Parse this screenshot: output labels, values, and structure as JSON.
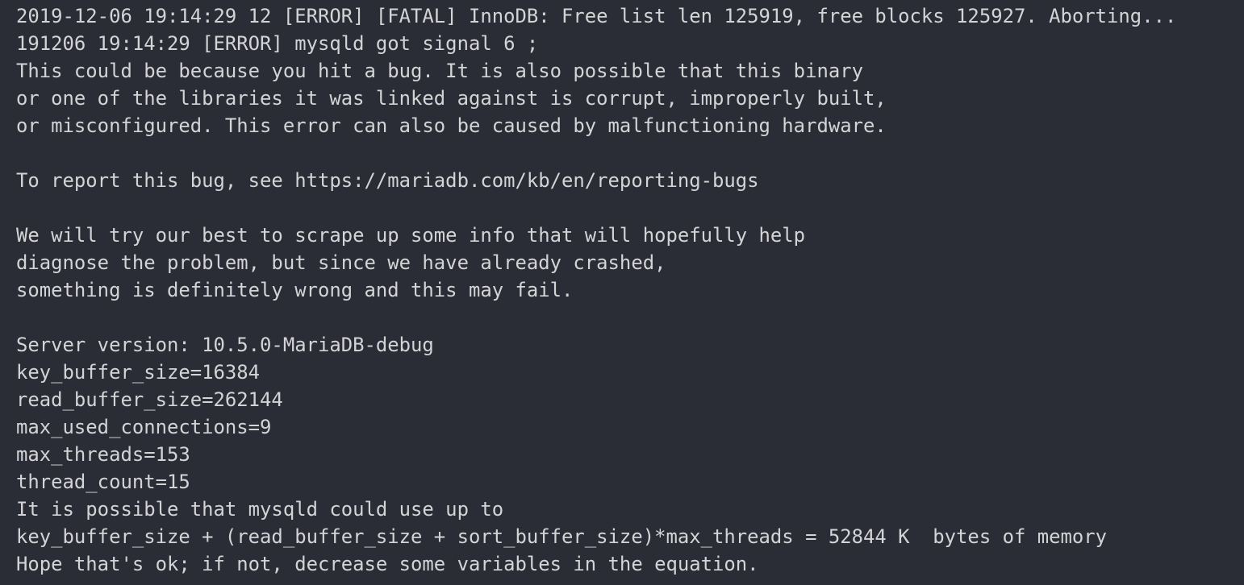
{
  "log": {
    "lines": [
      "2019-12-06 19:14:29 12 [ERROR] [FATAL] InnoDB: Free list len 125919, free blocks 125927. Aborting...",
      "191206 19:14:29 [ERROR] mysqld got signal 6 ;",
      "This could be because you hit a bug. It is also possible that this binary",
      "or one of the libraries it was linked against is corrupt, improperly built,",
      "or misconfigured. This error can also be caused by malfunctioning hardware.",
      "",
      "To report this bug, see https://mariadb.com/kb/en/reporting-bugs",
      "",
      "We will try our best to scrape up some info that will hopefully help",
      "diagnose the problem, but since we have already crashed,",
      "something is definitely wrong and this may fail.",
      "",
      "Server version: 10.5.0-MariaDB-debug",
      "key_buffer_size=16384",
      "read_buffer_size=262144",
      "max_used_connections=9",
      "max_threads=153",
      "thread_count=15",
      "It is possible that mysqld could use up to",
      "key_buffer_size + (read_buffer_size + sort_buffer_size)*max_threads = 52844 K  bytes of memory",
      "Hope that's ok; if not, decrease some variables in the equation."
    ]
  },
  "colors": {
    "background": "#2b2d36",
    "text": "#d4d4d6"
  }
}
